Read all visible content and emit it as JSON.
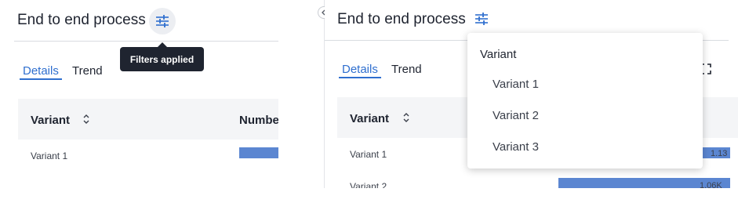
{
  "left_panel": {
    "title": "End to end process",
    "tabs": [
      {
        "label": "Details",
        "active": true
      },
      {
        "label": "Trend",
        "active": false
      }
    ],
    "columns": [
      "Variant",
      "Numbe"
    ],
    "rows": [
      {
        "label": "Variant 1"
      }
    ],
    "tooltip": "Filters applied"
  },
  "right_panel": {
    "title": "End to end process",
    "tabs": [
      {
        "label": "Details",
        "active": true
      },
      {
        "label": "Trend",
        "active": false
      }
    ],
    "columns": [
      "Variant"
    ],
    "rows": [
      {
        "label": "Variant 1",
        "value_label": "1.13"
      },
      {
        "label": "Variant 2",
        "value_label": "1.06K"
      }
    ],
    "filter_dropdown": {
      "heading": "Variant",
      "options": [
        "Variant 1",
        "Variant 2",
        "Variant 3"
      ]
    }
  },
  "icons": {
    "filter": "sliders-icon",
    "sort": "sort-updown-icon",
    "collapse": "chevron-left-icon",
    "expand": "fullscreen-icon"
  },
  "colors": {
    "accent": "#2f6fcf",
    "bar": "#5b86d1",
    "filter_button_bg": "#eceef2",
    "header_bg": "#f4f5f7",
    "tooltip_bg": "#1f2430"
  }
}
